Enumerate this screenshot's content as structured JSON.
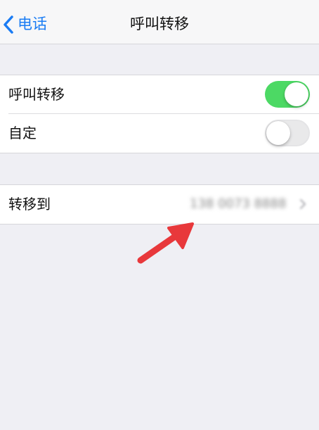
{
  "navbar": {
    "back_label": "电话",
    "title": "呼叫转移"
  },
  "settings": {
    "call_forwarding": {
      "label": "呼叫转移",
      "enabled": true
    },
    "custom": {
      "label": "自定",
      "enabled": false
    },
    "forward_to": {
      "label": "转移到",
      "value": "138 0073 8888"
    }
  },
  "colors": {
    "accent": "#1a7cf4",
    "toggle_on": "#4cd964",
    "background": "#efeff4",
    "annotation_arrow": "#e8383b"
  },
  "icons": {
    "back": "chevron-left-icon",
    "disclosure": "chevron-right-icon",
    "annotation": "red-arrow-icon"
  }
}
